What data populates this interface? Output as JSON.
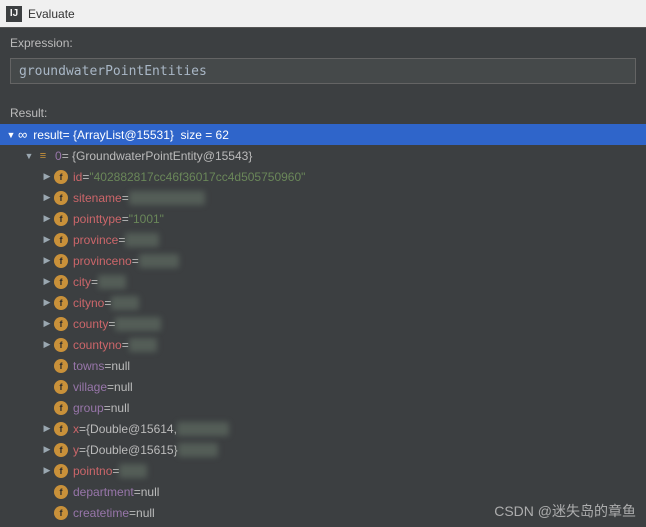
{
  "window": {
    "title": "Evaluate"
  },
  "labels": {
    "expression": "Expression:",
    "result": "Result:"
  },
  "expression_value": "groundwaterPointEntities",
  "result_header": {
    "name": "result",
    "type": "{ArrayList@15531}",
    "size_label": "size = 62"
  },
  "item0": {
    "index": "0",
    "type": "{GroundwaterPointEntity@15543}"
  },
  "fields": [
    {
      "name": "id",
      "expandable": true,
      "eq": " = ",
      "valuekind": "str",
      "value": "\"402882817cc46f36017cc4d505750960\""
    },
    {
      "name": "sitename",
      "expandable": true,
      "eq": " = ",
      "valuekind": "blur",
      "value": "xxxxxxxxxxxx"
    },
    {
      "name": "pointtype",
      "expandable": true,
      "eq": " = ",
      "valuekind": "str",
      "value": "\"1001\""
    },
    {
      "name": "province",
      "expandable": true,
      "eq": " = ",
      "valuekind": "blur",
      "value": "xxxxx"
    },
    {
      "name": "provinceno",
      "expandable": true,
      "eq": " = ",
      "valuekind": "blur",
      "value": "xxxxxx"
    },
    {
      "name": "city",
      "expandable": true,
      "eq": " = ",
      "valuekind": "blur",
      "value": "xxxx"
    },
    {
      "name": "cityno",
      "expandable": true,
      "eq": " = ",
      "valuekind": "blur",
      "value": "xxxx"
    },
    {
      "name": "county",
      "expandable": true,
      "eq": " = ",
      "valuekind": "blur",
      "value": "xxxxxxx"
    },
    {
      "name": "countyno",
      "expandable": true,
      "eq": " = ",
      "valuekind": "blur",
      "value": "xxxx"
    },
    {
      "name": "towns",
      "expandable": false,
      "eq": " = ",
      "valuekind": "plain",
      "value": "null"
    },
    {
      "name": "village",
      "expandable": false,
      "eq": " = ",
      "valuekind": "plain",
      "value": "null"
    },
    {
      "name": "group",
      "expandable": false,
      "eq": " = ",
      "valuekind": "plain",
      "value": "null"
    },
    {
      "name": "x",
      "expandable": true,
      "eq": " = ",
      "valuekind": "mixed",
      "value": "{Double@15614,",
      "blurtail": "xxxxxxxx"
    },
    {
      "name": "y",
      "expandable": true,
      "eq": " = ",
      "valuekind": "mixed",
      "value": "{Double@15615}",
      "blurtail": "xxxxxx"
    },
    {
      "name": "pointno",
      "expandable": true,
      "eq": " = ",
      "valuekind": "blur",
      "value": "xxxx"
    },
    {
      "name": "department",
      "expandable": false,
      "eq": " = ",
      "valuekind": "plain",
      "value": "null"
    },
    {
      "name": "createtime",
      "expandable": false,
      "eq": " = ",
      "valuekind": "plain",
      "value": "null"
    }
  ],
  "watermark": "CSDN @迷失岛的章鱼"
}
